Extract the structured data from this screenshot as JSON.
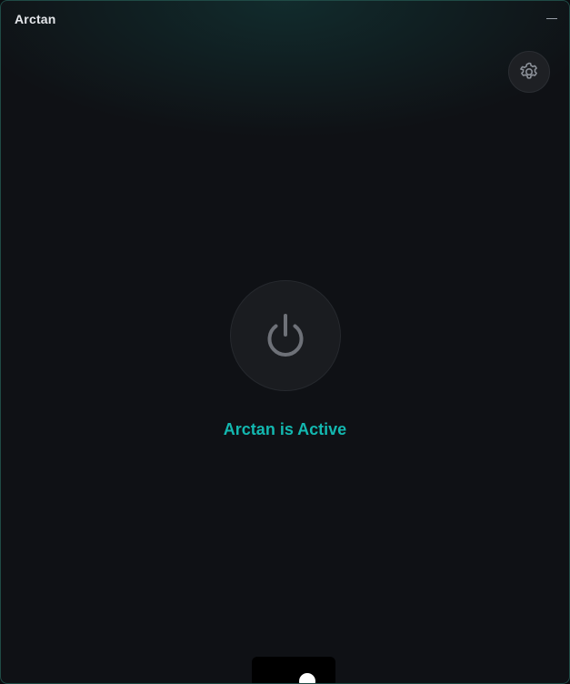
{
  "window": {
    "title": "Arctan"
  },
  "controls": {
    "minimize_icon": "minimize-icon",
    "settings_icon": "gear-icon",
    "power_icon": "power-icon"
  },
  "status": {
    "text": "Arctan is Active",
    "color": "#13b8b0"
  },
  "colors": {
    "background": "#0f1115",
    "accent": "#13b8b0",
    "border": "#1f4a45"
  }
}
